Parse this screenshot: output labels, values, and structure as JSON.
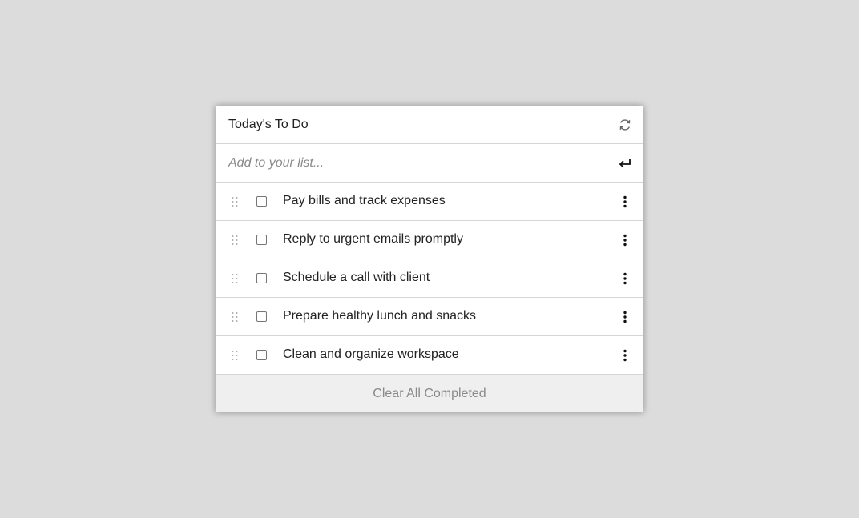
{
  "header": {
    "title": "Today's To Do",
    "refresh_icon": "refresh-icon"
  },
  "add_item": {
    "placeholder": "Add to your list...",
    "value": "",
    "submit_icon": "enter-icon"
  },
  "tasks": [
    {
      "label": "Pay bills and track expenses",
      "checked": false
    },
    {
      "label": "Reply to urgent emails promptly",
      "checked": false
    },
    {
      "label": "Schedule a call with client",
      "checked": false
    },
    {
      "label": "Prepare healthy lunch and snacks",
      "checked": false
    },
    {
      "label": "Clean and organize workspace",
      "checked": false
    }
  ],
  "footer": {
    "clear_label": "Clear All Completed"
  },
  "colors": {
    "background": "#dcdcdc",
    "panel": "#ffffff",
    "footer": "#efefef",
    "muted_text": "#8a8a8a"
  }
}
